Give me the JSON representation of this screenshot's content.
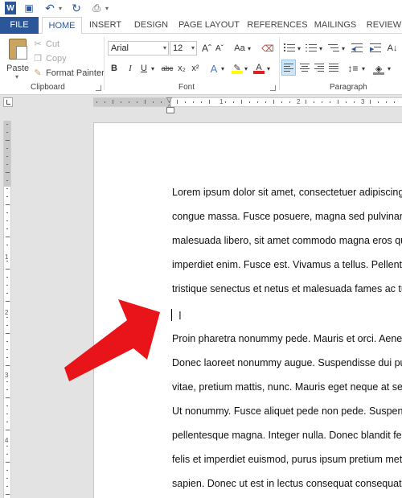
{
  "window": {
    "app_icon": "W"
  },
  "quick_access": [
    {
      "name": "word-icon",
      "glyph": "W"
    },
    {
      "name": "save-icon",
      "glyph": "▣"
    },
    {
      "name": "undo-icon",
      "glyph": "↶"
    },
    {
      "name": "redo-icon",
      "glyph": "↻"
    },
    {
      "name": "print-preview-icon",
      "glyph": "⎙"
    }
  ],
  "tabs": [
    "FILE",
    "HOME",
    "INSERT",
    "DESIGN",
    "PAGE LAYOUT",
    "REFERENCES",
    "MAILINGS",
    "REVIEW"
  ],
  "ribbon": {
    "clipboard": {
      "paste_label": "Paste",
      "cut_label": "Cut",
      "copy_label": "Copy",
      "format_painter_label": "Format Painter",
      "group_label": "Clipboard"
    },
    "font": {
      "font_name": "Arial",
      "font_size": "12",
      "group_label": "Font",
      "buttons": [
        "B",
        "I",
        "U",
        "abc",
        "x₂",
        "x²",
        "A",
        "Aa",
        "Aˆ",
        "Aˇ"
      ]
    },
    "paragraph": {
      "group_label": "Paragraph"
    }
  },
  "ruler": {
    "h_numbers": [
      "1",
      "2",
      "3"
    ],
    "v_numbers": [
      "1",
      "2",
      "3",
      "4"
    ]
  },
  "document": {
    "paragraph1": [
      "Lorem ipsum dolor sit amet, consectetuer adipiscing elit. Maecenas porttitor",
      "congue massa. Fusce posuere, magna sed pulvinar ultricies, purus lectus",
      "malesuada libero, sit amet commodo magna eros quis urna. Nunc viverra",
      "imperdiet enim. Fusce est. Vivamus a tellus. Pellentesque habitant morbi",
      "tristique senectus et netus et malesuada fames ac turpis egestas."
    ],
    "paragraph2": [
      "Proin pharetra nonummy pede. Mauris et orci. Aenean nec lorem. In porttitor.",
      "Donec laoreet nonummy augue. Suspendisse dui purus, scelerisque at,",
      "vitae, pretium mattis, nunc. Mauris eget neque at sem venenatis eleifend.",
      "Ut nonummy. Fusce aliquet pede non pede. Suspendisse dapibus lorem",
      "pellentesque magna. Integer nulla. Donec blandit feugiat ligula. Donec hendrerit,",
      "felis et imperdiet euismod, purus ipsum pretium metus, in lacinia nulla nisl",
      "sapien. Donec ut est in lectus consequat consequat."
    ]
  },
  "colors": {
    "accent": "#2b579a",
    "arrow": "#e8141a"
  }
}
